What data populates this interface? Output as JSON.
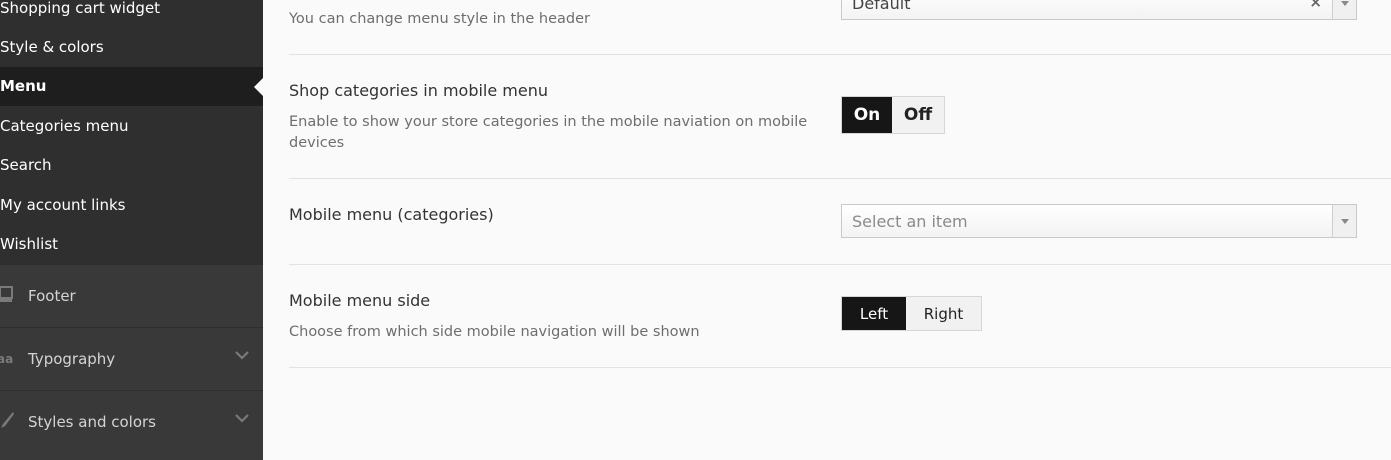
{
  "sidebar": {
    "subitems": [
      {
        "label": "Shopping cart widget",
        "active": false
      },
      {
        "label": "Style & colors",
        "active": false
      },
      {
        "label": "Menu",
        "active": true
      },
      {
        "label": "Categories menu",
        "active": false
      },
      {
        "label": "Search",
        "active": false
      },
      {
        "label": "My account links",
        "active": false
      },
      {
        "label": "Wishlist",
        "active": false
      }
    ],
    "groups": [
      {
        "label": "Footer",
        "icon": "monitor-icon"
      },
      {
        "label": "Typography",
        "icon": "font-size-icon"
      },
      {
        "label": "Styles and colors",
        "icon": "brush-icon"
      }
    ]
  },
  "main": {
    "menu_style": {
      "description": "You can change menu style in the header",
      "value": "Default",
      "clear": "×"
    },
    "shop_categories": {
      "title": "Shop categories in mobile menu",
      "description": "Enable to show your store categories in the mobile naviation on mobile devices",
      "on_label": "On",
      "off_label": "Off",
      "selected": "On"
    },
    "mobile_menu_categories": {
      "title": "Mobile menu (categories)",
      "placeholder": "Select an item"
    },
    "mobile_menu_side": {
      "title": "Mobile menu side",
      "description": "Choose from which side mobile navigation will be shown",
      "left_label": "Left",
      "right_label": "Right",
      "selected": "Left"
    }
  }
}
